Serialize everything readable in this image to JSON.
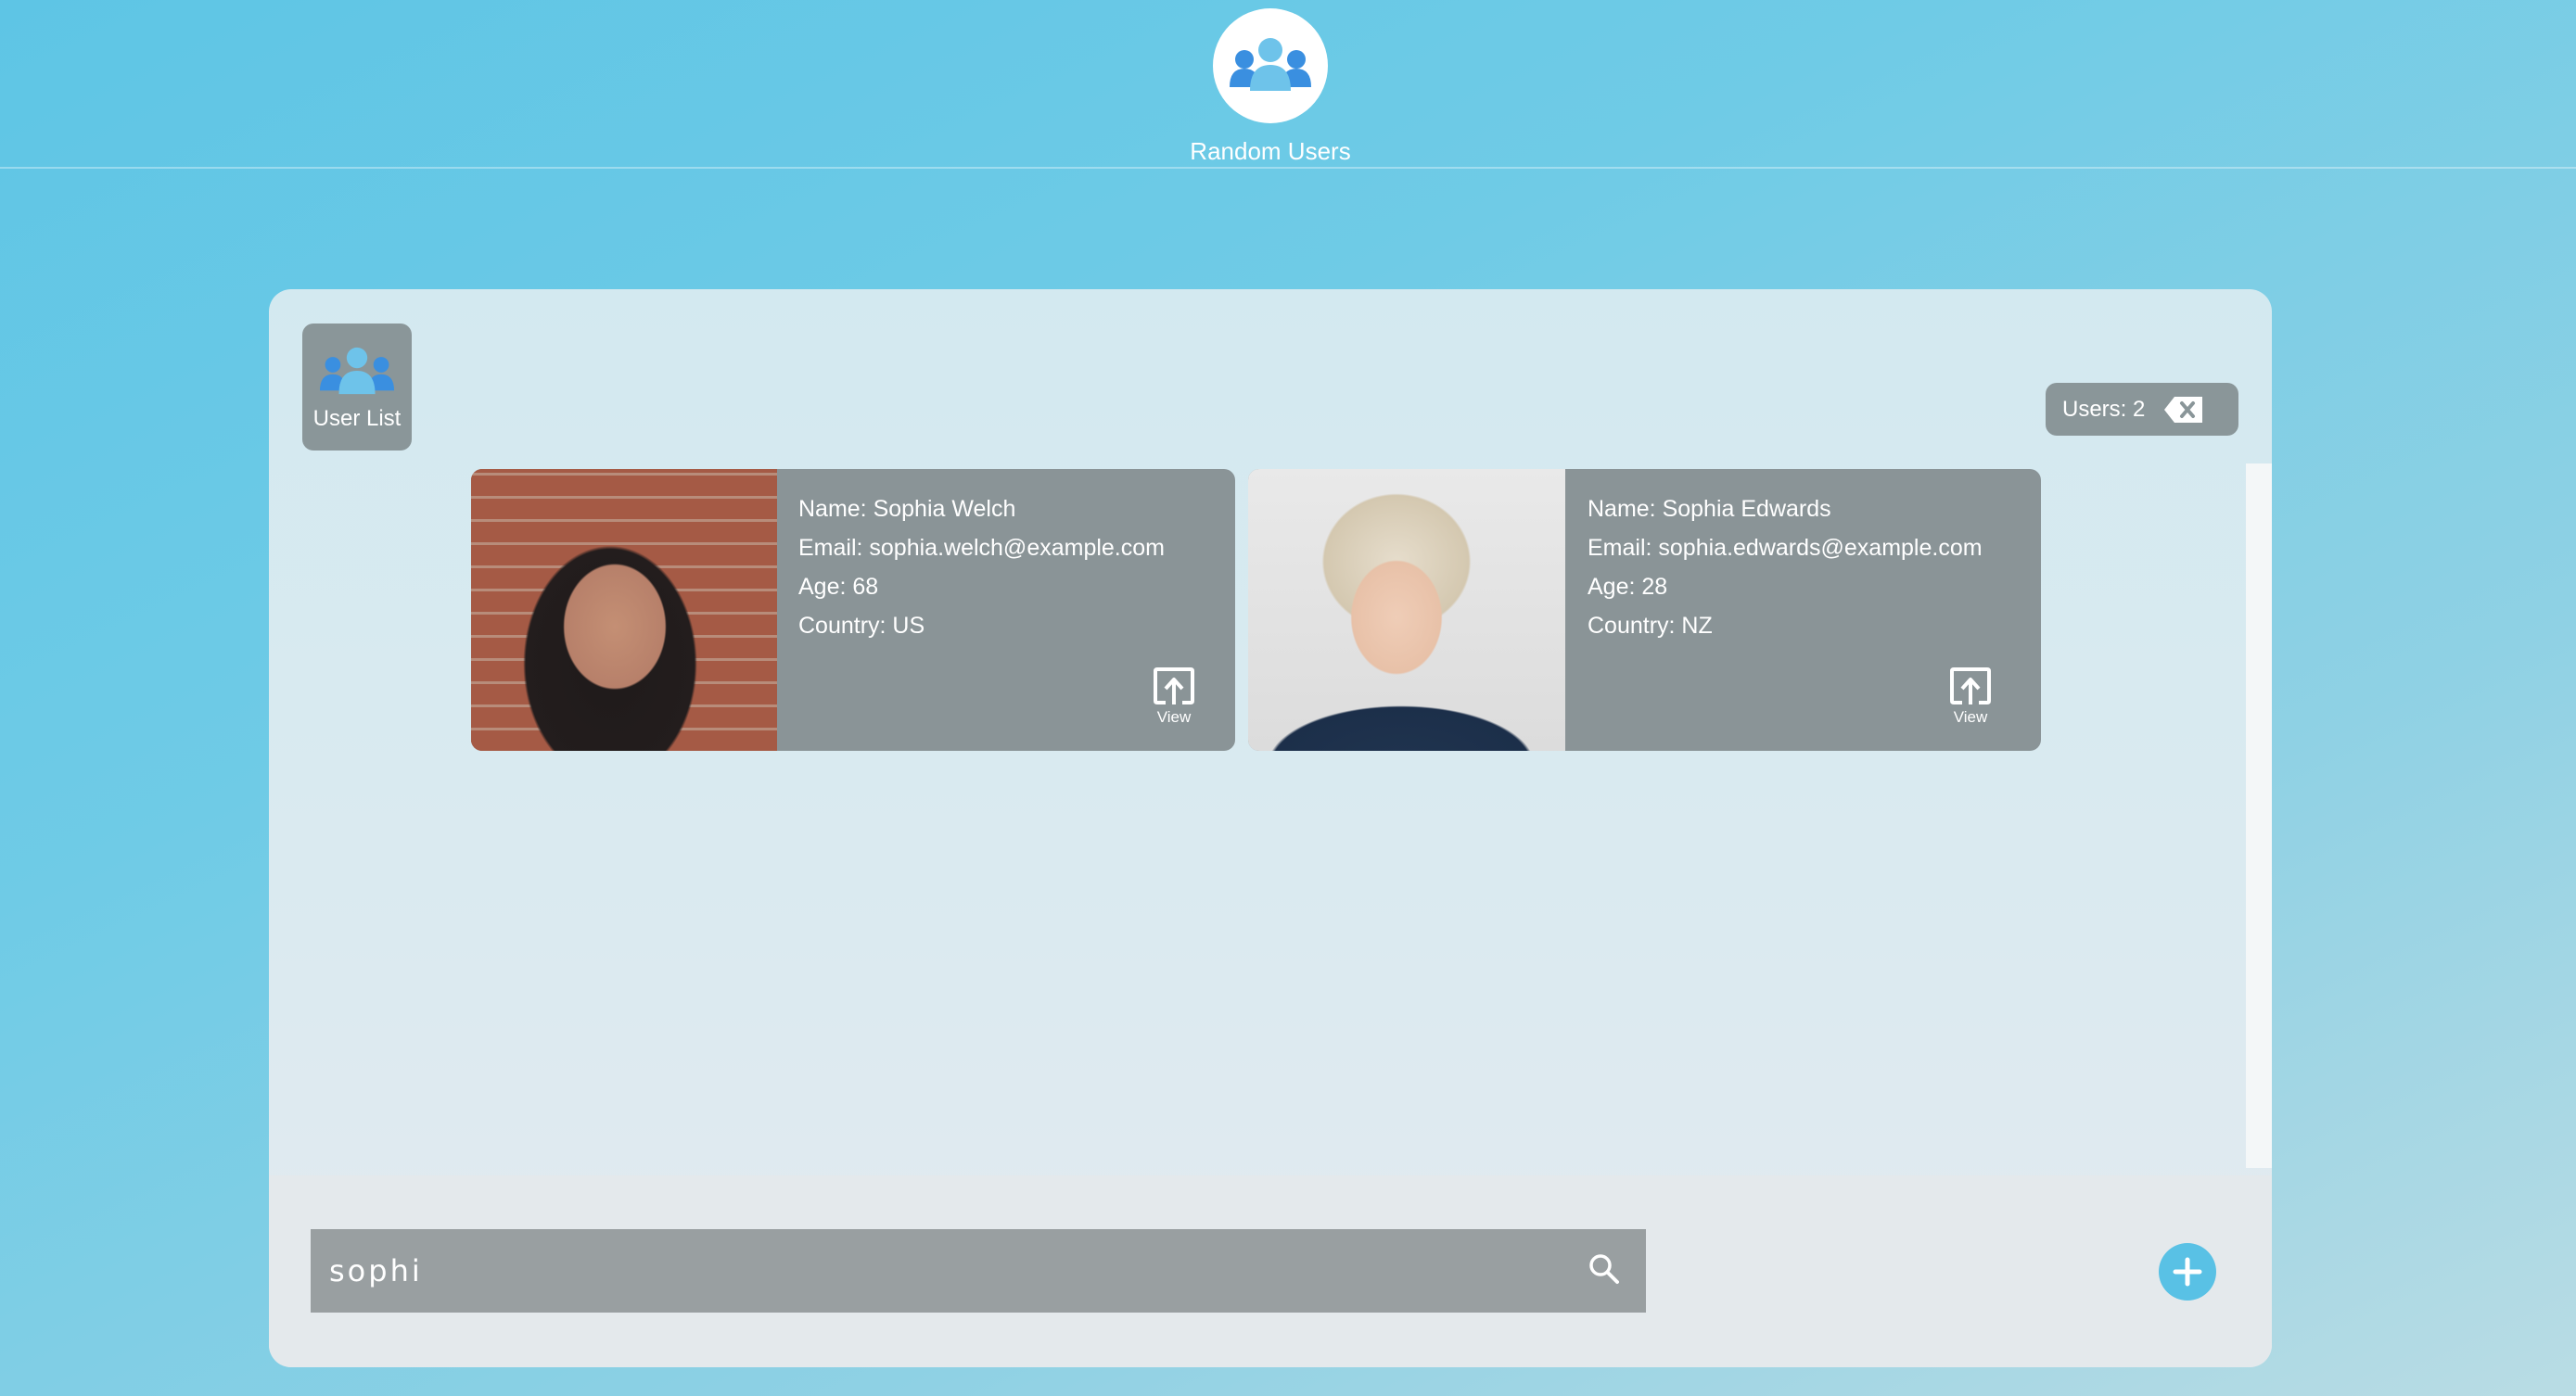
{
  "header": {
    "logo_icon": "users-group-icon",
    "title": "Random Users"
  },
  "nav": {
    "tab_label": "User List",
    "tab_icon": "users-group-icon"
  },
  "toolbar": {
    "users_count_label": "Users: 2",
    "clear_icon": "backspace-clear-icon"
  },
  "cards": [
    {
      "name": "Name: Sophia Welch",
      "email": "Email: sophia.welch@example.com",
      "age": "Age: 68",
      "country": "Country: US",
      "view_label": "View"
    },
    {
      "name": "Name: Sophia Edwards",
      "email": "Email: sophia.edwards@example.com",
      "age": "Age: 28",
      "country": "Country: NZ",
      "view_label": "View"
    }
  ],
  "search": {
    "value": "sophi",
    "icon": "search-icon"
  },
  "add_button": {
    "icon": "plus-icon"
  },
  "colors": {
    "accent": "#59c1e5",
    "card_bg": "#8a9497",
    "icon_light_blue": "#6ec3ea",
    "icon_blue": "#3a8fe0"
  }
}
